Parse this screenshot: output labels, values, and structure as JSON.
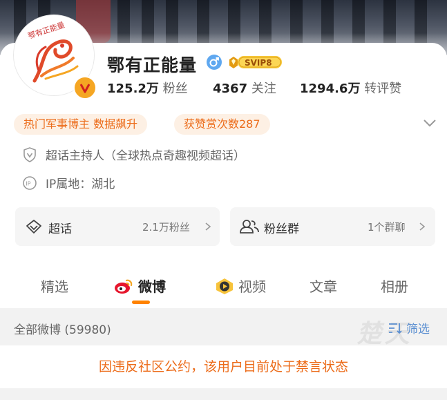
{
  "profile": {
    "name": "鄂有正能量",
    "vip_badge": "SVIP8",
    "avatar_text": "鄂有正能量",
    "verified_icon": "v-badge-icon"
  },
  "stats": {
    "followers_value": "125.2万",
    "followers_label": "粉丝",
    "following_value": "4367",
    "following_label": "关注",
    "likes_value": "1294.6万",
    "likes_label": "转评赞"
  },
  "tags": [
    "热门军事博主 数据飙升",
    "获赞赏次数287"
  ],
  "info": {
    "host": "超话主持人（全球热点奇趣视频超话）",
    "ip": "IP属地：湖北"
  },
  "boxes": {
    "supertopic_label": "超话",
    "supertopic_value": "2.1万粉丝",
    "fangroup_label": "粉丝群",
    "fangroup_value": "1个群聊"
  },
  "tabs": [
    "精选",
    "微博",
    "视频",
    "文章",
    "相册"
  ],
  "active_tab": "微博",
  "feed": {
    "count_label": "全部微博 (59980)",
    "filter_label": "筛选",
    "watermark": "楚天"
  },
  "banned_notice": "因违反社区公约，该用户目前处于禁言状态",
  "colors": {
    "accent": "#ff8200",
    "tag_text": "#ec6c1a",
    "tag_bg": "#fdf0e4",
    "filter_blue": "#5b8fd1"
  }
}
